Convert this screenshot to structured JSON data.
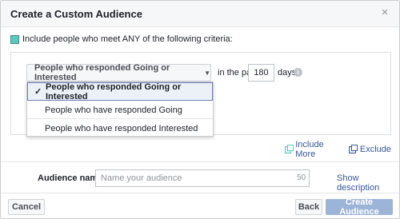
{
  "dialog": {
    "title": "Create a Custom Audience",
    "close_glyph": "×"
  },
  "criteria": {
    "text": "Include people who meet ANY of the following criteria:"
  },
  "rule": {
    "selected_option": "People who responded Going or Interested",
    "in_the_past_label": "in the past",
    "days_value": "180",
    "days_label": "days",
    "info_glyph": "i"
  },
  "dropdown": {
    "options": [
      {
        "label": "People who responded Going or Interested",
        "selected": true
      },
      {
        "label": "People who have responded Going",
        "selected": false
      },
      {
        "label": "People who have responded Interested",
        "selected": false
      }
    ],
    "check_glyph": "✓"
  },
  "actions": {
    "include_more": "Include More",
    "exclude": "Exclude"
  },
  "audience_name": {
    "label": "Audience name",
    "placeholder": "Name your audience",
    "char_limit": "50",
    "show_description": "Show description"
  },
  "footer": {
    "cancel": "Cancel",
    "back": "Back",
    "create": "Create Audience"
  },
  "colors": {
    "accent_teal": "#5cc9c0",
    "link_blue": "#365899",
    "create_button_disabled": "#9cb4d8"
  }
}
